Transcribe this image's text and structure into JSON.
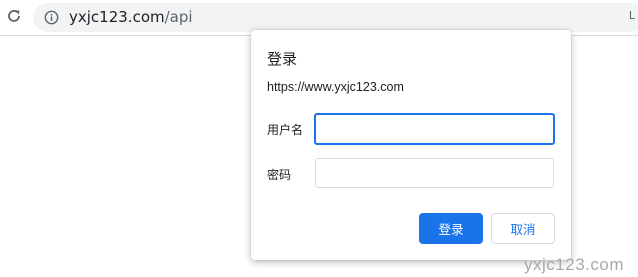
{
  "browser": {
    "url_host": "yxjc123.com",
    "url_path": "/api",
    "reload_icon": "reload-icon",
    "site_info_icon": "info-icon",
    "edge_glyph": "L"
  },
  "dialog": {
    "title": "登录",
    "origin": "https://www.yxjc123.com",
    "username_label": "用户名",
    "username_value": "",
    "password_label": "密码",
    "password_value": "",
    "signin_button": "登录",
    "cancel_button": "取消"
  },
  "watermark": "yxjc123.com",
  "colors": {
    "accent": "#1a73e8",
    "omnibox_bg": "#f1f3f4"
  }
}
